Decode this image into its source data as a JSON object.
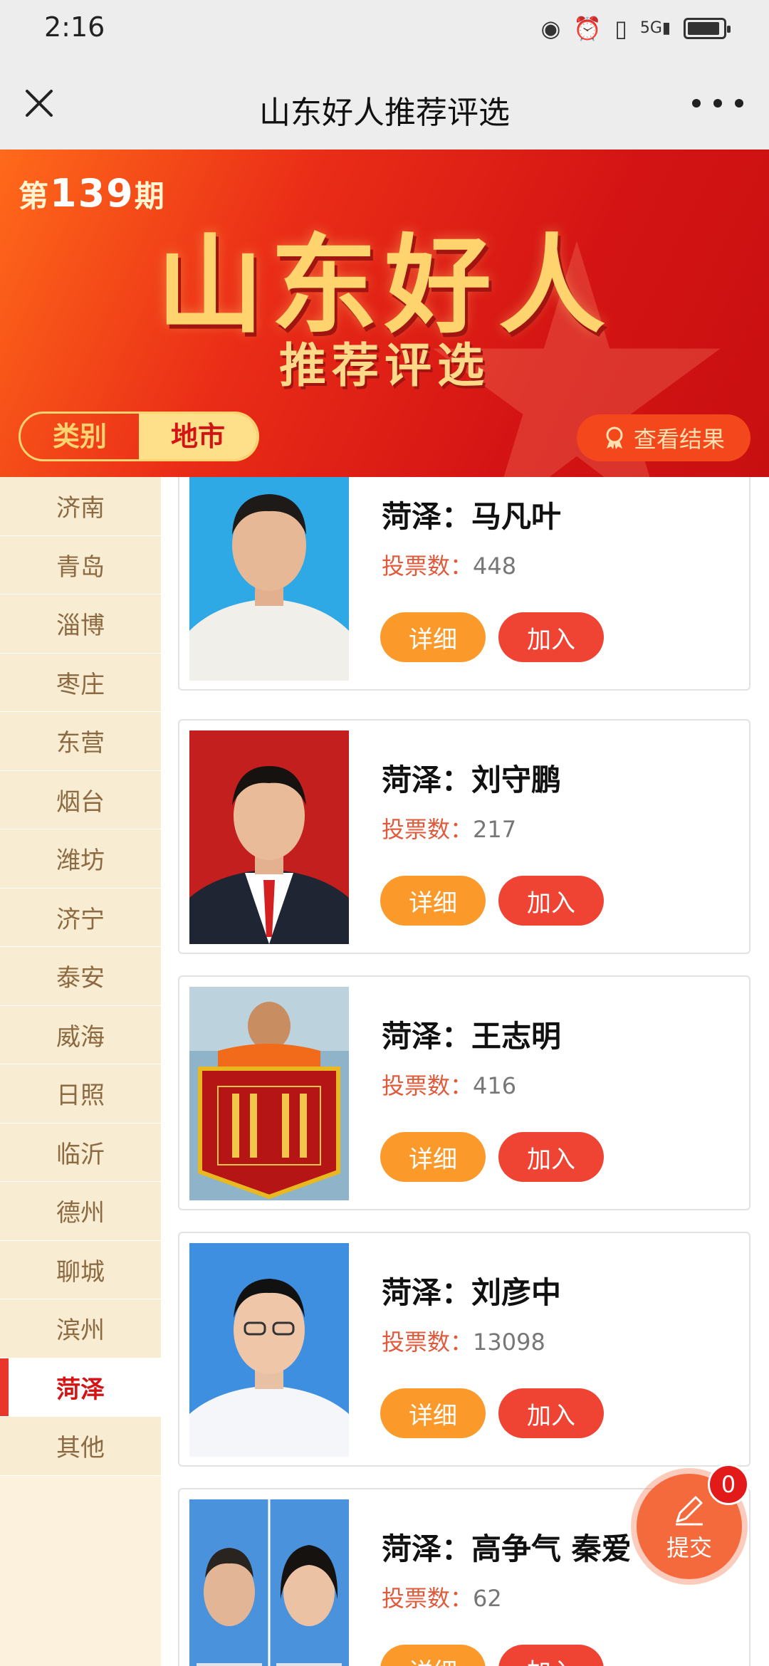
{
  "status_bar": {
    "time": "2:16",
    "icons": [
      "eye-icon",
      "alarm-icon",
      "vibrate-icon",
      "5g-signal-icon",
      "battery-icon"
    ]
  },
  "title_bar": {
    "title": "山东好人推荐评选"
  },
  "banner": {
    "issue_prefix": "第",
    "issue_number": "139",
    "issue_suffix": "期",
    "title": "山东好人",
    "subtitle": "推荐评选",
    "tabs": [
      {
        "label": "类别",
        "active": false
      },
      {
        "label": "地市",
        "active": true
      }
    ],
    "result_button": "查看结果"
  },
  "sidebar": {
    "items": [
      {
        "label": "济南"
      },
      {
        "label": "青岛"
      },
      {
        "label": "淄博"
      },
      {
        "label": "枣庄"
      },
      {
        "label": "东营"
      },
      {
        "label": "烟台"
      },
      {
        "label": "潍坊"
      },
      {
        "label": "济宁"
      },
      {
        "label": "泰安"
      },
      {
        "label": "威海"
      },
      {
        "label": "日照"
      },
      {
        "label": "临沂"
      },
      {
        "label": "德州"
      },
      {
        "label": "聊城"
      },
      {
        "label": "滨州"
      },
      {
        "label": "菏泽",
        "active": true
      },
      {
        "label": "其他"
      }
    ]
  },
  "cards": [
    {
      "name": "菏泽：马凡叶",
      "votes_label": "投票数：",
      "votes": "448",
      "detail": "详细",
      "join": "加入"
    },
    {
      "name": "菏泽：刘守鹏",
      "votes_label": "投票数：",
      "votes": "217",
      "detail": "详细",
      "join": "加入"
    },
    {
      "name": "菏泽：王志明",
      "votes_label": "投票数：",
      "votes": "416",
      "detail": "详细",
      "join": "加入"
    },
    {
      "name": "菏泽：刘彦中",
      "votes_label": "投票数：",
      "votes": "13098",
      "detail": "详细",
      "join": "加入"
    },
    {
      "name": "菏泽：高争气 秦爱",
      "votes_label": "投票数：",
      "votes": "62",
      "detail": "详细",
      "join": "加入"
    }
  ],
  "submit": {
    "label": "提交",
    "count": "0"
  },
  "colors": {
    "brand_red": "#d41414",
    "orange": "#fb9a2a",
    "join_red": "#ef4433",
    "gold": "#ffd36e"
  }
}
